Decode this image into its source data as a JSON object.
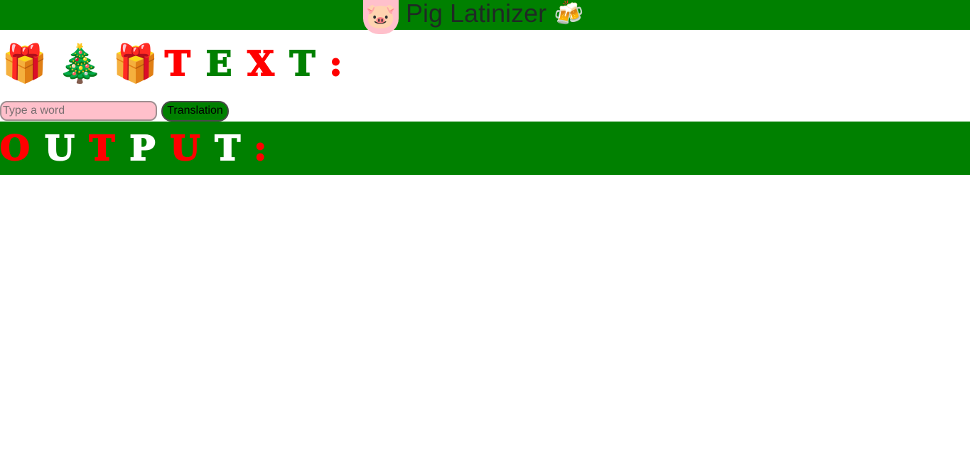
{
  "header": {
    "title": "Pig Latinizer",
    "left_icon": "pig-face-icon",
    "left_icon_glyph": "🐷",
    "right_icon": "beer-mugs-icon",
    "right_icon_glyph": "🍻",
    "bg_color": "#008000",
    "pig_bg_color": "#ffc0cb"
  },
  "text_section": {
    "icons": [
      {
        "name": "gift-icon",
        "glyph": "🎁"
      },
      {
        "name": "christmas-tree-icon",
        "glyph": "🎄"
      },
      {
        "name": "gift-icon",
        "glyph": "🎁"
      }
    ],
    "label_letters": [
      {
        "char": "T",
        "color": "#ff0000"
      },
      {
        "char": "E",
        "color": "#008000"
      },
      {
        "char": "X",
        "color": "#ff0000"
      },
      {
        "char": "T",
        "color": "#008000"
      },
      {
        "char": ":",
        "color": "#ff0000"
      }
    ]
  },
  "form": {
    "input_placeholder": "Type a word",
    "input_value": "",
    "button_label": "Translation",
    "input_bg": "#ffc0cb",
    "button_bg": "#008000"
  },
  "output_section": {
    "bg_color": "#008000",
    "label_letters": [
      {
        "char": "O",
        "color": "#ff0000"
      },
      {
        "char": "U",
        "color": "#ffffff"
      },
      {
        "char": "T",
        "color": "#ff0000"
      },
      {
        "char": "P",
        "color": "#ffffff"
      },
      {
        "char": "U",
        "color": "#ff0000"
      },
      {
        "char": "T",
        "color": "#ffffff"
      },
      {
        "char": ":",
        "color": "#ff0000"
      }
    ],
    "result": ""
  }
}
